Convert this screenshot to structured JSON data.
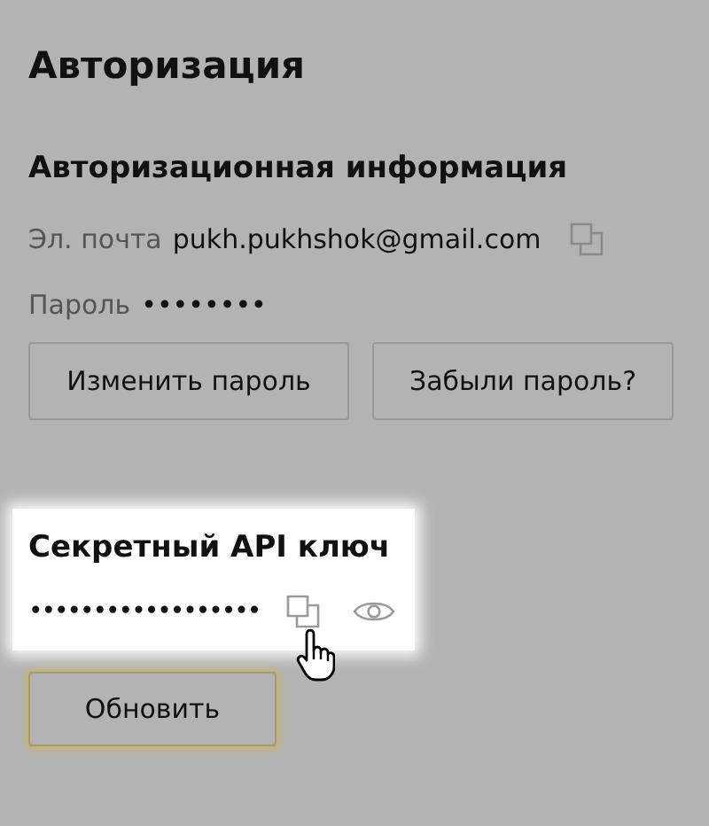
{
  "title": "Авторизация",
  "auth_info": {
    "heading": "Авторизационная информация",
    "email_label": "Эл. почта",
    "email": "pukh.pukhshok@gmail.com",
    "password_label": "Пароль",
    "password": "••••••••",
    "buttons": [
      "Изменить пароль",
      "Забыли пароль?"
    ]
  },
  "api_key": {
    "heading": "Секретный API ключ",
    "value": "••••••••••••••••••"
  },
  "refresh_button": "Обновить"
}
